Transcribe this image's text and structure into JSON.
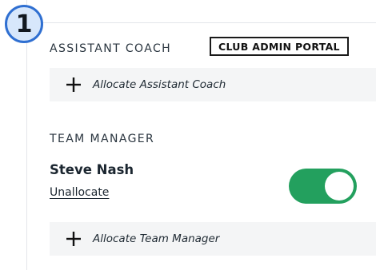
{
  "step_badge": "1",
  "portal_badge": "CLUB ADMIN PORTAL",
  "assistant_coach": {
    "heading": "ASSISTANT COACH",
    "allocate_label": "Allocate Assistant Coach"
  },
  "team_manager": {
    "heading": "TEAM MANAGER",
    "name": "Steve Nash",
    "unallocate_label": "Unallocate",
    "toggle_on": true,
    "allocate_label": "Allocate Team Manager"
  },
  "colors": {
    "toggle_on": "#23a05e",
    "badge_border": "#2f6fd1",
    "badge_fill": "#d7e7fb",
    "row_background": "#f4f5f6"
  },
  "icons": [
    "plus-icon"
  ]
}
